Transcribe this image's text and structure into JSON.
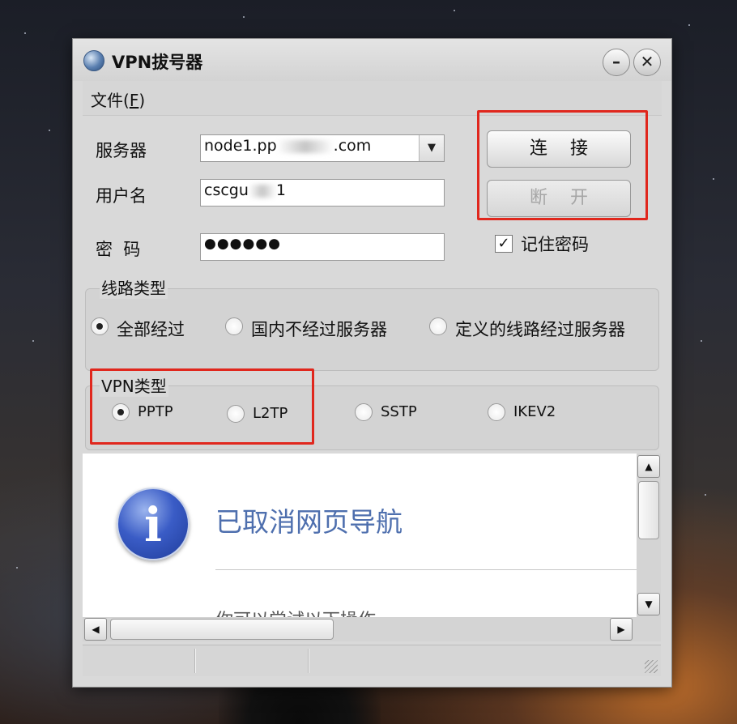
{
  "window": {
    "title": "VPN拔号器",
    "minimize_symbol": "–",
    "close_symbol": "✕"
  },
  "menu": {
    "file_prefix": "文件(",
    "file_key": "F",
    "file_suffix": ")"
  },
  "form": {
    "server_label": "服务器",
    "server_value_a": "node1.pp",
    "server_value_b": ".com",
    "username_label": "用户名",
    "username_value_a": "cscgu",
    "username_value_b": "1",
    "password_label": "密  码",
    "password_value": "●●●●●●"
  },
  "buttons": {
    "connect": "连接",
    "disconnect": "断开"
  },
  "remember_password": {
    "label": "记住密码",
    "checked": true,
    "mark": "✓"
  },
  "route_group": {
    "title": "线路类型",
    "options": [
      "全部经过",
      "国内不经过服务器",
      "定义的线路经过服务器"
    ],
    "selected": 0
  },
  "vpn_type_group": {
    "title": "VPN类型",
    "options": [
      "PPTP",
      "L2TP",
      "SSTP",
      "IKEV2"
    ],
    "selected": 0
  },
  "webview": {
    "icon": "info-icon",
    "title": "已取消网页导航",
    "subtitle_partial": "你可以尝试以下操作"
  },
  "scrollbars": {
    "up": "▲",
    "down": "▼",
    "left": "◀",
    "right": "▶"
  },
  "colors": {
    "highlight": "#e0271d",
    "webview_title": "#4e6fae"
  }
}
